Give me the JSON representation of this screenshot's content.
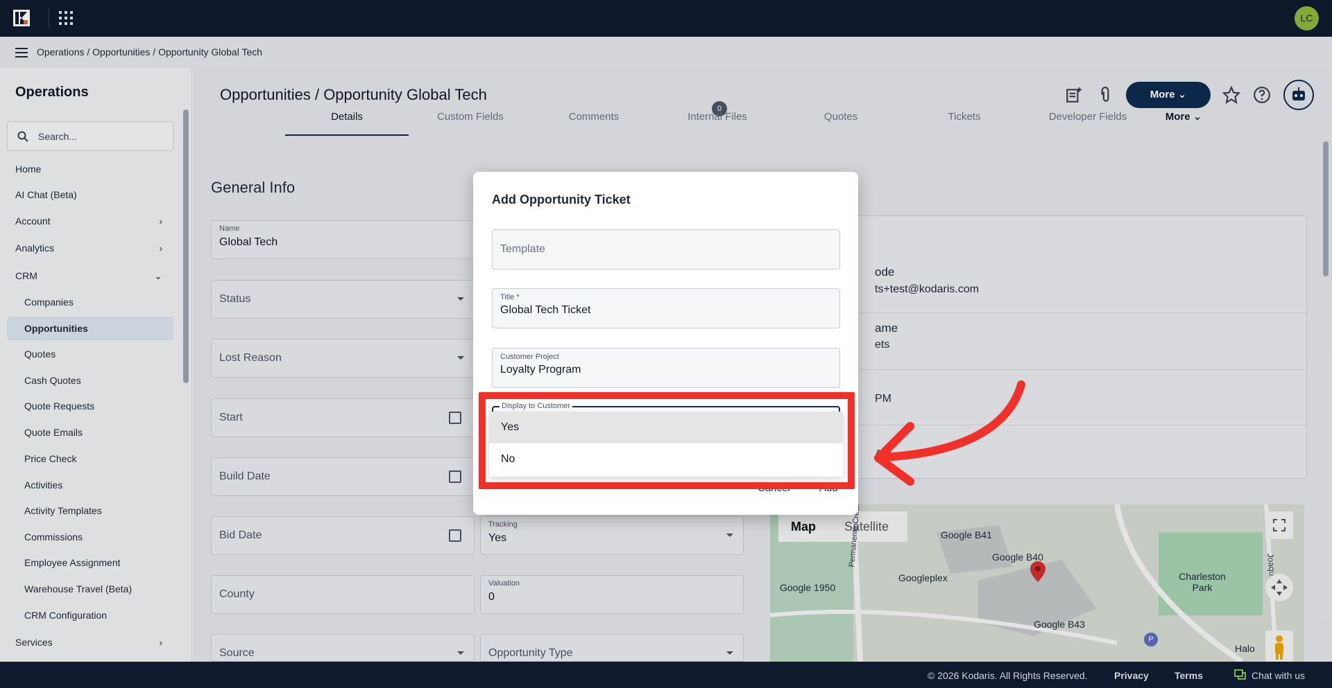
{
  "colors": {
    "topbar": "#0f1a2e",
    "accent": "#0f2a4f",
    "avatar": "#8db63c",
    "highlight": "#f2302a",
    "chat": "#8bc34a"
  },
  "topbar": {
    "avatar_initials": "LC"
  },
  "breadcrumb": "Operations / Opportunities / Opportunity Global Tech",
  "sidebar": {
    "title": "Operations",
    "search_placeholder": "Search...",
    "items": [
      {
        "label": "Home"
      },
      {
        "label": "AI Chat (Beta)"
      },
      {
        "label": "Account",
        "chevron": "›"
      },
      {
        "label": "Analytics",
        "chevron": "›"
      },
      {
        "label": "CRM",
        "chevron": "⌄"
      },
      {
        "label": "Companies"
      },
      {
        "label": "Opportunities"
      },
      {
        "label": "Quotes"
      },
      {
        "label": "Cash Quotes"
      },
      {
        "label": "Quote Requests"
      },
      {
        "label": "Quote Emails"
      },
      {
        "label": "Price Check"
      },
      {
        "label": "Activities"
      },
      {
        "label": "Activity Templates"
      },
      {
        "label": "Commissions"
      },
      {
        "label": "Employee Assignment"
      },
      {
        "label": "Warehouse Travel (Beta)"
      },
      {
        "label": "CRM Configuration"
      },
      {
        "label": "Services",
        "chevron": "›"
      }
    ]
  },
  "header": {
    "title": "Opportunities / Opportunity Global Tech",
    "more_label": "More"
  },
  "tabs": [
    {
      "label": "Details"
    },
    {
      "label": "Custom Fields"
    },
    {
      "label": "Comments",
      "badge": "0"
    },
    {
      "label": "Internal Files"
    },
    {
      "label": "Quotes"
    },
    {
      "label": "Tickets"
    },
    {
      "label": "Developer Fields"
    },
    {
      "label": "More"
    }
  ],
  "general_info": {
    "title": "General Info",
    "name_label": "Name",
    "name_value": "Global Tech",
    "status_ph": "Status",
    "lost_reason_ph": "Lost Reason",
    "start_ph": "Start",
    "build_date_ph": "Build Date",
    "bid_date_ph": "Bid Date",
    "tracking_label": "Tracking",
    "tracking_value": "Yes",
    "county_ph": "County",
    "valuation_label": "Valuation",
    "valuation_value": "0",
    "source_ph": "Source",
    "opportunity_type_ph": "Opportunity Type"
  },
  "right_card": {
    "row1_title": "ode",
    "row1_sub": "ts+test@kodaris.com",
    "row2_title": "ame",
    "row2_sub": "ets",
    "row3_text": "PM",
    "row4_text": "AM"
  },
  "map": {
    "map_label": "Map",
    "satellite_label": "Satellite",
    "places": [
      "Google B41",
      "Google B40",
      "Googleplex",
      "Google 1950",
      "Charleston Park",
      "Google B43",
      "Halo",
      "Permanente Creek",
      "Joaquin Rd",
      "P"
    ]
  },
  "modal": {
    "title": "Add Opportunity Ticket",
    "template_ph": "Template",
    "title_label": "Title *",
    "title_value": "Global Tech Ticket",
    "project_label": "Customer Project",
    "project_value": "Loyalty Program",
    "display_label": "Display to Customer",
    "options": [
      "Yes",
      "No"
    ],
    "cancel_label": "Cancel",
    "add_label": "Add"
  },
  "footer": {
    "copyright": "© 2026 Kodaris. All Rights Reserved.",
    "privacy": "Privacy",
    "terms": "Terms",
    "chat": "Chat with us"
  }
}
